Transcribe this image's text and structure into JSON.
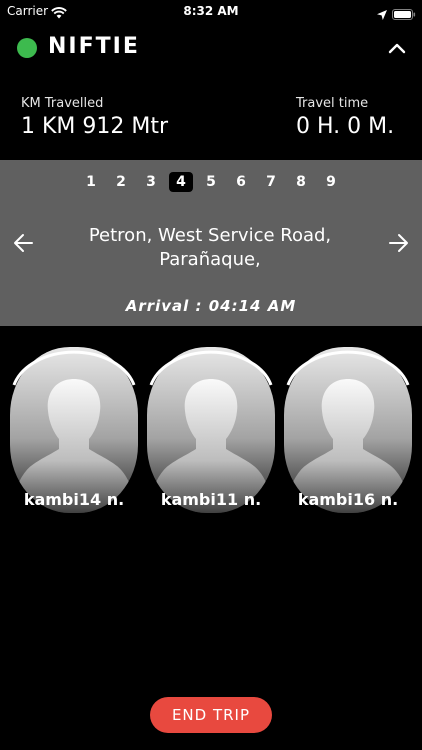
{
  "status_bar": {
    "carrier": "Carrier",
    "time": "8:32 AM",
    "icons": [
      "wifi-icon",
      "location-arrow-icon",
      "battery-icon"
    ]
  },
  "header": {
    "title": "NIFTIE",
    "status_color": "#3dba4e",
    "collapse_icon": "chevron-up-icon"
  },
  "stats": {
    "km_label": "KM Travelled",
    "km_value": "1 KM 912 Mtr",
    "time_label": "Travel time",
    "time_value": "0 H. 0 M."
  },
  "stops": {
    "tabs": [
      "1",
      "2",
      "3",
      "4",
      "5",
      "6",
      "7",
      "8",
      "9"
    ],
    "active_tab": "4",
    "address_line1": "Petron, West Service Road,",
    "address_line2": "Parañaque,",
    "arrival": "Arrival : 04:14 AM",
    "panel_color": "#606060"
  },
  "passengers": [
    {
      "name": "kambi14 n."
    },
    {
      "name": "kambi11 n."
    },
    {
      "name": "kambi16 n."
    }
  ],
  "actions": {
    "end_trip": "END TRIP",
    "end_trip_color": "#e8493f"
  }
}
